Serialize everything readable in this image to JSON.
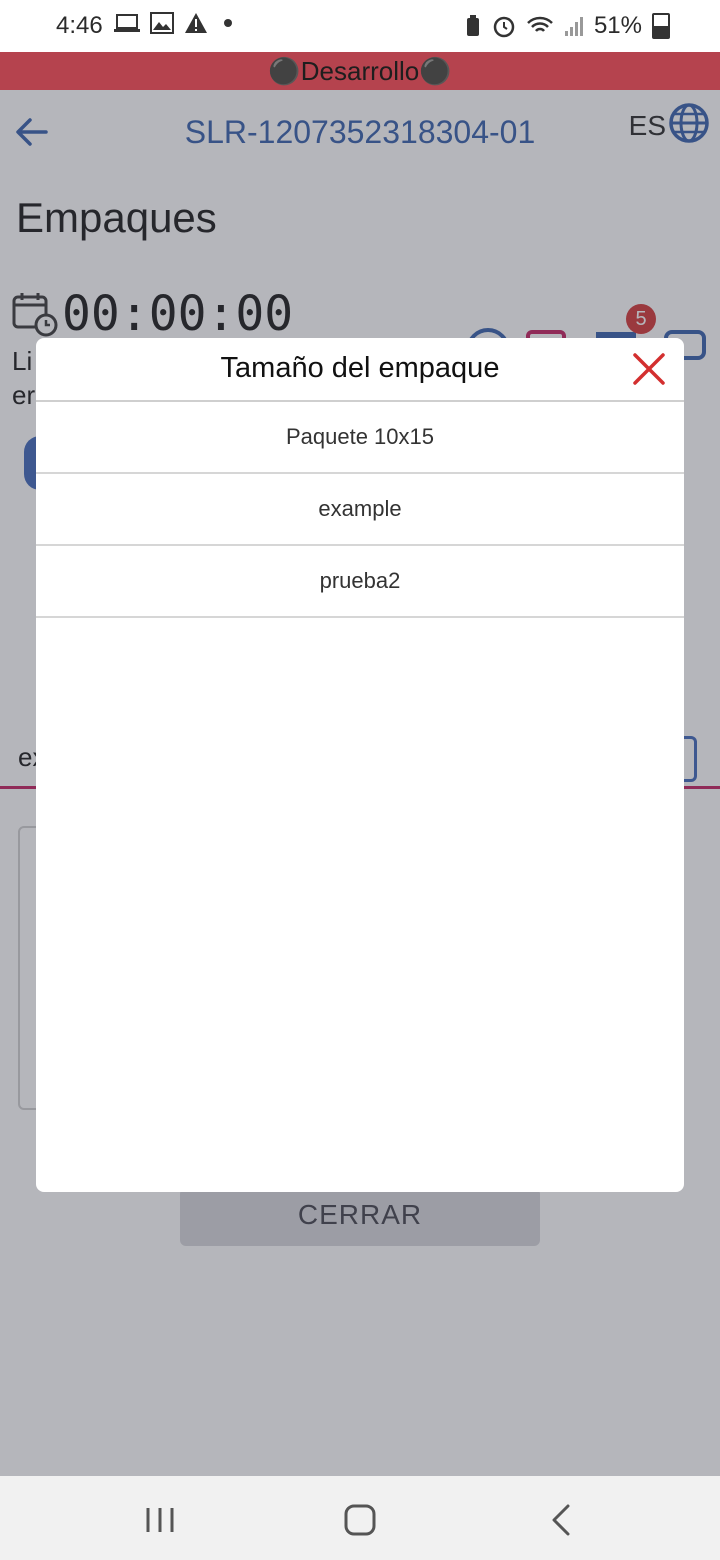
{
  "status_bar": {
    "time": "4:46",
    "battery": "51%"
  },
  "dev_banner": {
    "text": "Desarrollo",
    "icon_left": "bomb-icon",
    "icon_right": "bomb-icon"
  },
  "header": {
    "order_id": "SLR-1207352318304-01",
    "language": "ES"
  },
  "page": {
    "title": "Empaques",
    "timer": "00:00:00",
    "badge_count": "5",
    "bg_text_1": "Li",
    "bg_text_2": "er",
    "bg_field_text": "ex",
    "close_button_label": "CERRAR"
  },
  "modal": {
    "title": "Tamaño del empaque",
    "options": [
      {
        "label": "Paquete 10x15"
      },
      {
        "label": "example"
      },
      {
        "label": "prueba2"
      }
    ]
  },
  "colors": {
    "accent_blue": "#2f5aa8",
    "banner": "#b5434e",
    "close_red": "#d32f2f",
    "underline": "#c2185b"
  }
}
